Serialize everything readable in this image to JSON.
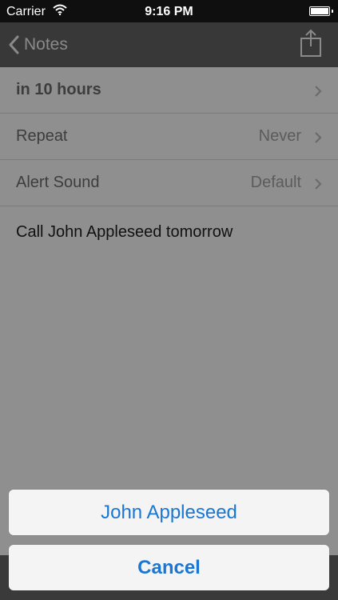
{
  "status_bar": {
    "carrier": "Carrier",
    "time": "9:16 PM",
    "battery_level": 1.0
  },
  "nav": {
    "back_label": "Notes"
  },
  "rows": [
    {
      "label": "in 10 hours",
      "value": ""
    },
    {
      "label": "Repeat",
      "value": "Never"
    },
    {
      "label": "Alert Sound",
      "value": "Default"
    }
  ],
  "note_text": "Call John Appleseed tomorrow",
  "action_sheet": {
    "option_label": "John Appleseed",
    "cancel_label": "Cancel"
  },
  "colors": {
    "accent": "#1a76d2",
    "overlay": "#8f8f8f",
    "bar": "#383838"
  }
}
